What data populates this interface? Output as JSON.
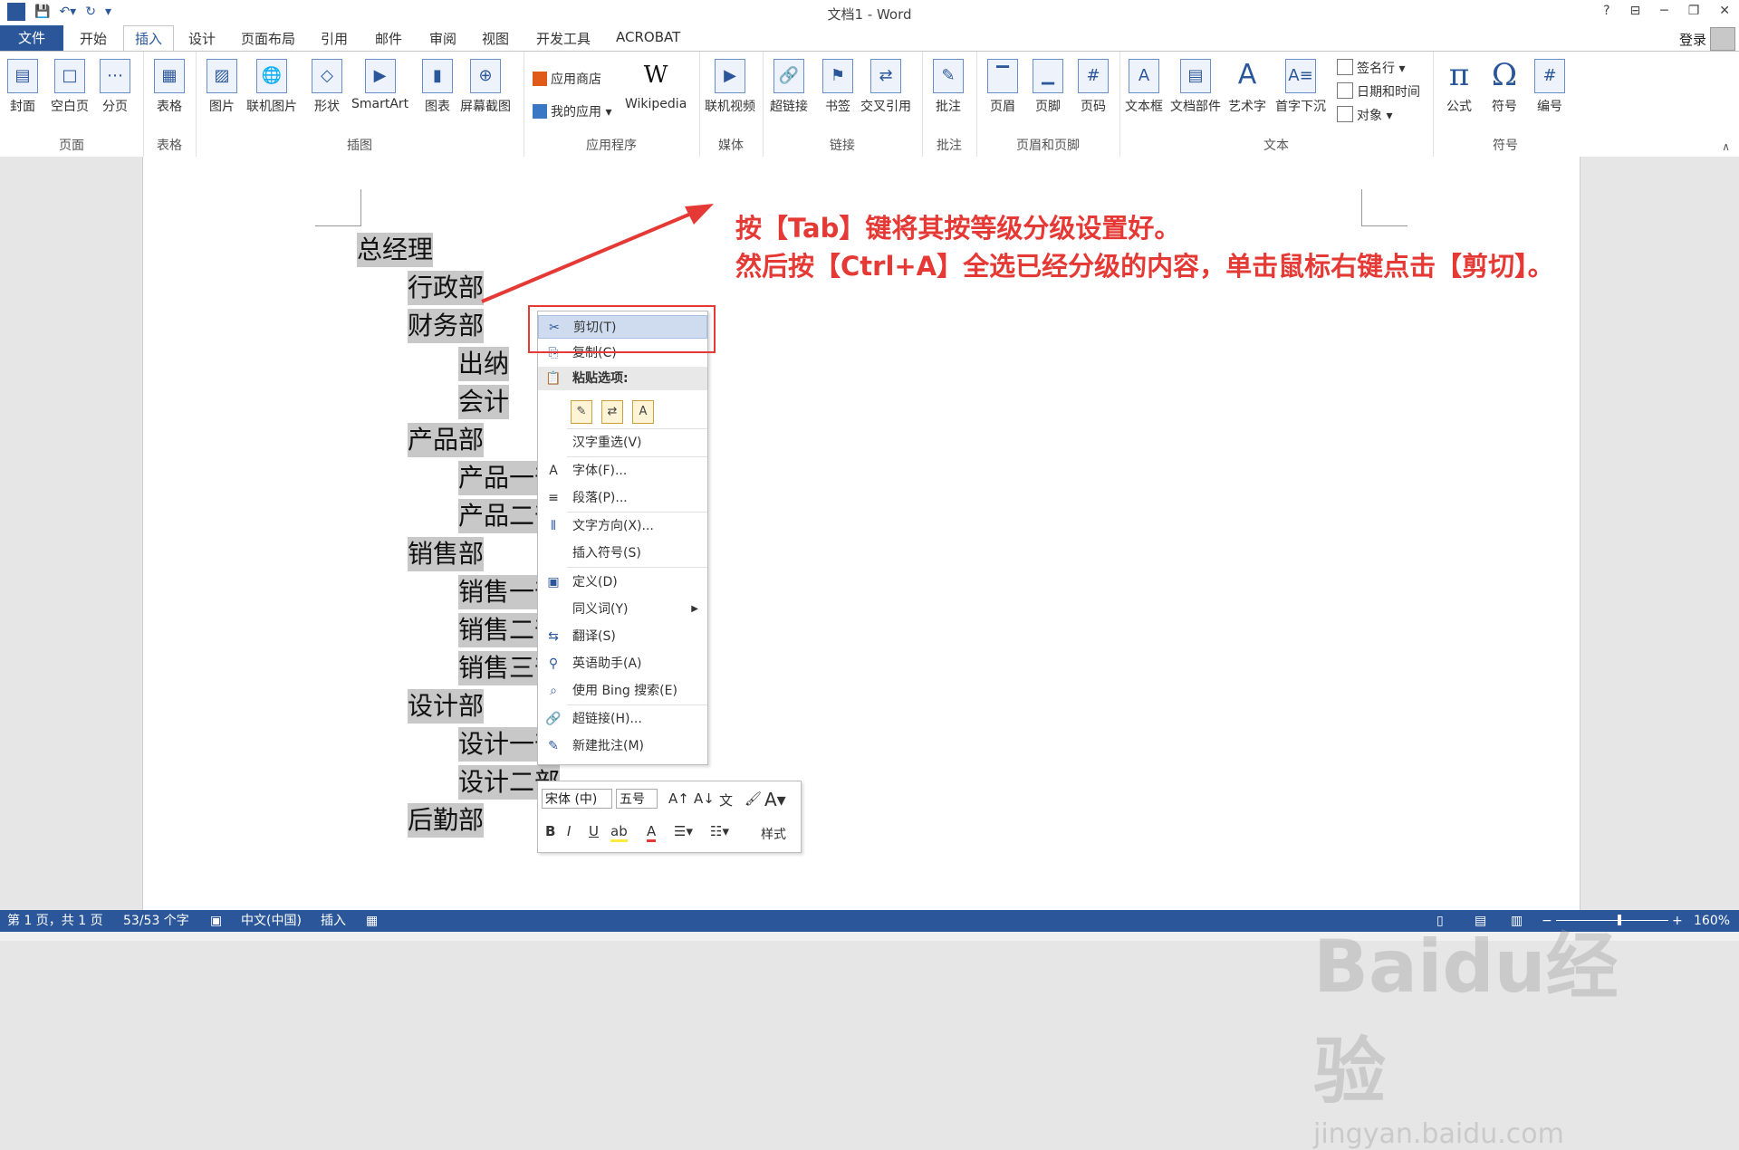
{
  "window": {
    "title": "文档1 - Word",
    "help": "?",
    "restore_ribbon": "⊟",
    "minimize": "─",
    "maximize": "❐",
    "close": "✕"
  },
  "tabs": [
    "文件",
    "开始",
    "插入",
    "设计",
    "页面布局",
    "引用",
    "邮件",
    "审阅",
    "视图",
    "开发工具",
    "ACROBAT"
  ],
  "account": {
    "login": "登录"
  },
  "ribbon": {
    "groups": {
      "page": "页面",
      "table": "表格",
      "illustrations": "插图",
      "apps": "应用程序",
      "media": "媒体",
      "links": "链接",
      "comments": "批注",
      "headerfooter": "页眉和页脚",
      "text": "文本",
      "symbols": "符号"
    },
    "buttons": {
      "cover": "封面",
      "blank": "空白页",
      "pagebreak": "分页",
      "table": "表格",
      "picture": "图片",
      "online_picture": "联机图片",
      "shapes": "形状",
      "smartart": "SmartArt",
      "chart": "图表",
      "screenshot": "屏幕截图",
      "store": "应用商店",
      "myapps": "我的应用",
      "wikipedia": "Wikipedia",
      "online_video": "联机视频",
      "hyperlink": "超链接",
      "bookmark": "书签",
      "crossref": "交叉引用",
      "comment": "批注",
      "header": "页眉",
      "footer": "页脚",
      "pagenum": "页码",
      "textbox": "文本框",
      "quickparts": "文档部件",
      "wordart": "艺术字",
      "dropcap": "首字下沉",
      "signature": "签名行",
      "datetime": "日期和时间",
      "object": "对象",
      "equation": "公式",
      "symbol": "符号",
      "number": "编号"
    }
  },
  "document": {
    "outline": [
      "总经理",
      "行政部",
      "财务部",
      "出纳",
      "会计",
      "产品部",
      "产品一部",
      "产品二部",
      "销售部",
      "销售一部",
      "销售二部",
      "销售三部",
      "设计部",
      "设计一部",
      "设计二部",
      "后勤部"
    ]
  },
  "annotation": {
    "line1": "按【Tab】键将其按等级分级设置好。",
    "line2": "然后按【Ctrl+A】全选已经分级的内容，单击鼠标右键点击【剪切】。"
  },
  "context_menu": {
    "cut": "剪切(T)",
    "copy": "复制(C)",
    "paste_options": "粘贴选项:",
    "hanzi": "汉字重选(V)",
    "font": "字体(F)...",
    "paragraph": "段落(P)...",
    "text_direction": "文字方向(X)...",
    "insert_symbol": "插入符号(S)",
    "define": "定义(D)",
    "synonyms": "同义词(Y)",
    "translate": "翻译(S)",
    "english_assistant": "英语助手(A)",
    "bing_search": "使用 Bing 搜索(E)",
    "hyperlink": "超链接(H)...",
    "new_comment": "新建批注(M)"
  },
  "mini_toolbar": {
    "font_name": "宋体 (中)",
    "font_size": "五号",
    "styles": "样式"
  },
  "status_bar": {
    "page": "第 1 页，共 1 页",
    "words": "53/53 个字",
    "language": "中文(中国)",
    "mode": "插入",
    "zoom": "160%"
  },
  "watermark": {
    "brand": "Baidu经验",
    "url": "jingyan.baidu.com"
  }
}
